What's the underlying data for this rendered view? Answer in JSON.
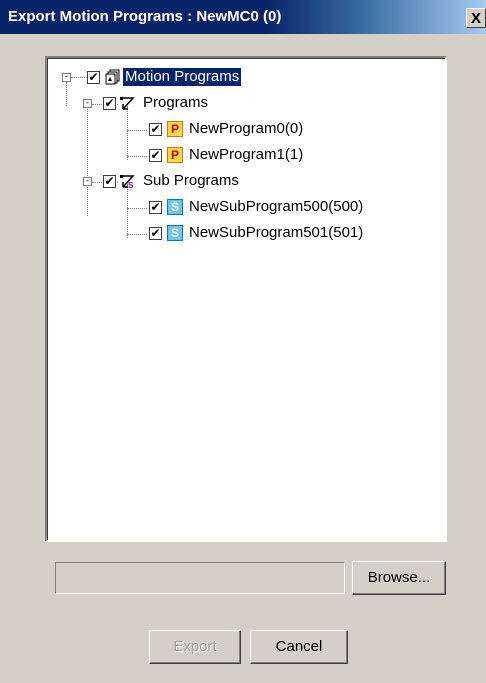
{
  "window": {
    "title": "Export Motion Programs : NewMC0 (0)",
    "close_label": "X"
  },
  "tree": {
    "root": {
      "label": "Motion Programs",
      "expander": "-",
      "checked": "✔",
      "icon": "motion-programs-icon"
    },
    "programs": {
      "label": "Programs",
      "expander": "-",
      "checked": "✔",
      "icon": "programs-folder-icon",
      "items": [
        {
          "label": "NewProgram0(0)",
          "checked": "✔",
          "icon_letter": "P"
        },
        {
          "label": "NewProgram1(1)",
          "checked": "✔",
          "icon_letter": "P"
        }
      ]
    },
    "sub_programs": {
      "label": "Sub Programs",
      "expander": "-",
      "checked": "✔",
      "icon": "sub-programs-folder-icon",
      "items": [
        {
          "label": "NewSubProgram500(500)",
          "checked": "✔",
          "icon_letter": "S"
        },
        {
          "label": "NewSubProgram501(501)",
          "checked": "✔",
          "icon_letter": "S"
        }
      ]
    }
  },
  "path": {
    "value": ""
  },
  "buttons": {
    "browse": "Browse...",
    "export": "Export",
    "cancel": "Cancel"
  },
  "colors": {
    "title_bar": "#0a246a",
    "dialog_bg": "#d4d0c8",
    "selection": "#0a246a"
  }
}
